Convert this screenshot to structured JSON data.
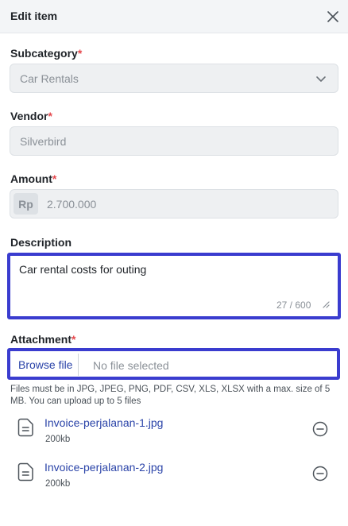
{
  "header": {
    "title": "Edit item"
  },
  "subcategory": {
    "label": "Subcategory",
    "required_mark": "*",
    "value": "Car Rentals"
  },
  "vendor": {
    "label": "Vendor",
    "required_mark": "*",
    "value": "Silverbird"
  },
  "amount": {
    "label": "Amount",
    "required_mark": "*",
    "prefix": "Rp",
    "value": "2.700.000"
  },
  "description": {
    "label": "Description",
    "value": "Car rental costs for outing",
    "char_count": "27 / 600"
  },
  "attachment": {
    "label": "Attachment",
    "required_mark": "*",
    "browse_label": "Browse file",
    "status": "No file selected",
    "hint": "Files must be in JPG, JPEG, PNG, PDF, CSV, XLS, XLSX with a max. size of 5 MB. You can upload up to 5 files",
    "files": [
      {
        "name": "Invoice-perjalanan-1.jpg",
        "size": "200kb"
      },
      {
        "name": "Invoice-perjalanan-2.jpg",
        "size": "200kb"
      }
    ]
  },
  "colors": {
    "focus_border": "#3a3ccf",
    "link": "#2a43a8",
    "required": "#e5484d"
  },
  "icons": {
    "close": "close-icon",
    "dropdown": "chevron-down-icon",
    "file": "document-icon",
    "remove": "minus-circle-icon"
  }
}
